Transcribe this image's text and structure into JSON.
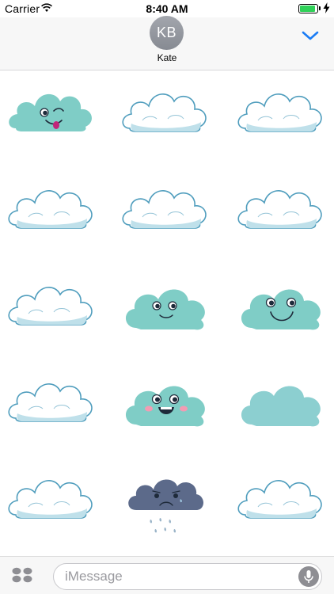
{
  "status_bar": {
    "carrier": "Carrier",
    "time": "8:40 AM",
    "battery_level": 0.9,
    "battery_color": "#2fd158"
  },
  "header": {
    "avatar_initials": "KB",
    "contact_name": "Kate",
    "collapse_icon": "chevron-down-icon",
    "accent_color": "#1a7cf5"
  },
  "stickers": [
    {
      "name": "sticker-cloud-winking-tongue",
      "kind": "winking-cloud"
    },
    {
      "name": "sticker-cloud-wide-flat",
      "kind": "plain-cloud"
    },
    {
      "name": "sticker-cloud-small-puff",
      "kind": "plain-cloud"
    },
    {
      "name": "sticker-cloud-tall-puffy",
      "kind": "plain-cloud"
    },
    {
      "name": "sticker-cloud-medium",
      "kind": "plain-cloud"
    },
    {
      "name": "sticker-cloud-small-rounded",
      "kind": "plain-cloud"
    },
    {
      "name": "sticker-cloud-long-flat",
      "kind": "plain-cloud"
    },
    {
      "name": "sticker-cloud-smiling",
      "kind": "smiling-cloud"
    },
    {
      "name": "sticker-cloud-big-smile",
      "kind": "big-smile-cloud"
    },
    {
      "name": "sticker-cloud-wispy",
      "kind": "plain-cloud"
    },
    {
      "name": "sticker-cloud-laughing-blush",
      "kind": "laughing-cloud"
    },
    {
      "name": "sticker-cloud-solid-teal",
      "kind": "solid-cloud"
    },
    {
      "name": "sticker-cloud-fluffy",
      "kind": "plain-cloud"
    },
    {
      "name": "sticker-cloud-sad-rain",
      "kind": "sad-rain-cloud"
    },
    {
      "name": "sticker-cloud-layered",
      "kind": "plain-cloud"
    }
  ],
  "palette": {
    "teal": "#7fcdc6",
    "cloud_white": "#ffffff",
    "cloud_shade": "#bfe0ea",
    "cloud_outline": "#4f9dbd",
    "storm_gray": "#5c6a8a"
  },
  "input_bar": {
    "apps_icon": "app-drawer-icon",
    "placeholder": "iMessage",
    "mic_icon": "microphone-icon"
  }
}
